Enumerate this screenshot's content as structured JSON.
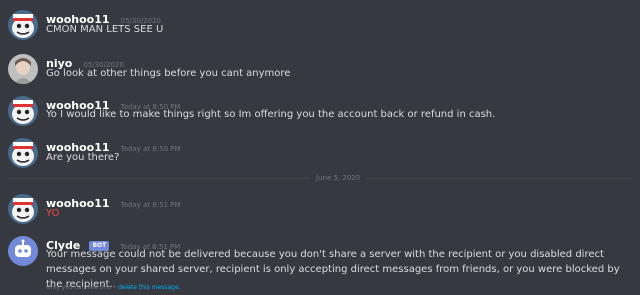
{
  "messages": [
    {
      "author": "woohoo11",
      "timestamp": "05/30/2020",
      "text": "CMON MAN LETS SEE U",
      "avatar": "cartoon-avatar"
    },
    {
      "author": "niyo",
      "timestamp": "05/30/2020",
      "text": "Go look at other things before you cant anymore",
      "avatar": "photo-avatar"
    },
    {
      "author": "woohoo11",
      "timestamp": "Today at 8:50 PM",
      "text": "Yo I would like to make things right so Im offering you the account back or refund in cash.",
      "avatar": "cartoon-avatar"
    },
    {
      "author": "woohoo11",
      "timestamp": "Today at 8:50 PM",
      "text": "Are you there?",
      "avatar": "cartoon-avatar"
    },
    {
      "author": "woohoo11",
      "timestamp": "Today at 8:51 PM",
      "text": "YO",
      "avatar": "cartoon-avatar",
      "color": "#f04747"
    }
  ],
  "divider": {
    "label": "June 5, 2020"
  },
  "clyde": {
    "author": "Clyde",
    "badge": "BOT",
    "timestamp": "Today at 8:51 PM",
    "text": "Your message could not be delivered because you don't share a server with the recipient or you disabled direct messages on your shared server, recipient is only accepting direct messages from friends, or you were blocked by the recipient.",
    "ephemeral_note": "Only you can see this •",
    "delete_link": "delete this message."
  },
  "colors": {
    "background": "#36393f",
    "bot_badge": "#7289da",
    "link": "#00b0f4",
    "error_text": "#f04747"
  }
}
